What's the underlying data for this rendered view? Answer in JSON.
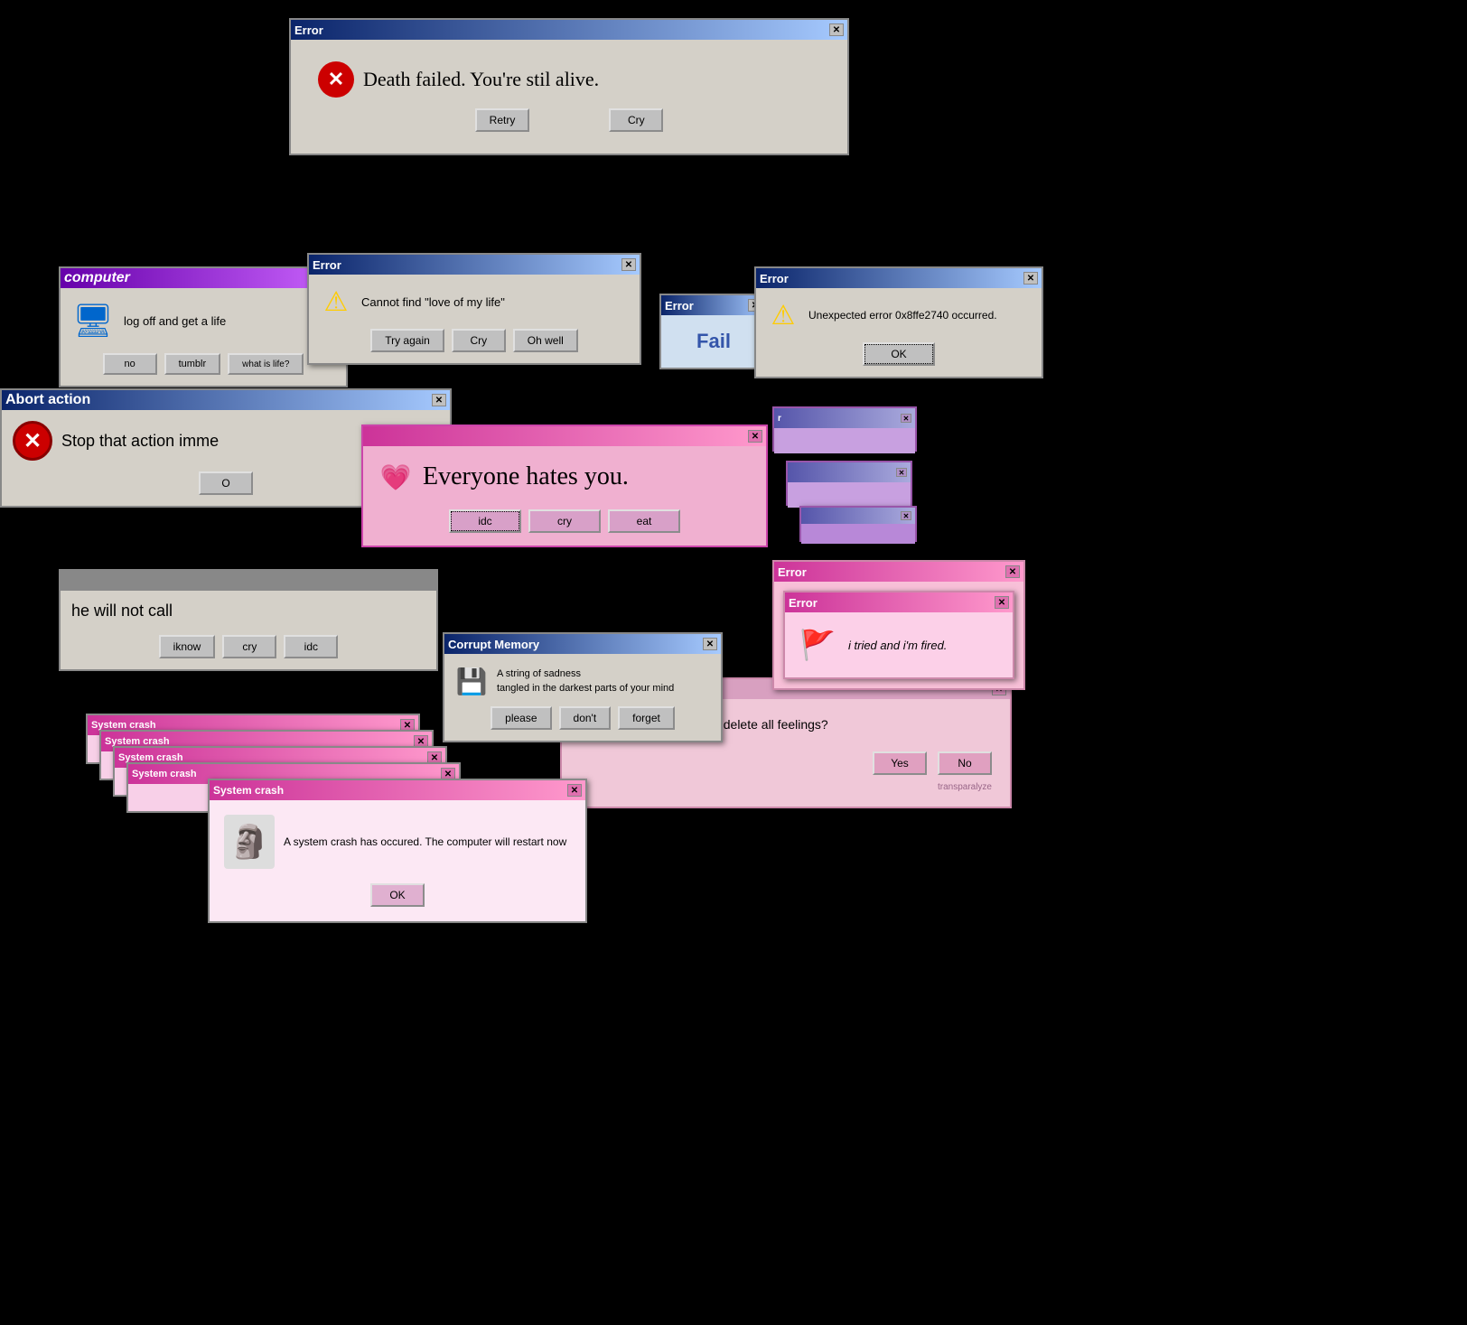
{
  "windows": {
    "death_error": {
      "title": "Error",
      "message": "Death failed. You're stil alive.",
      "btn1": "Retry",
      "btn2": "Cry"
    },
    "love_error": {
      "title": "Error",
      "message": "Cannot find \"love of my life\"",
      "btn1": "Try again",
      "btn2": "Cry",
      "btn3": "Oh well"
    },
    "computer": {
      "title": "computer",
      "message": "log off and get a life",
      "btn1": "no",
      "btn2": "tumblr",
      "btn3": "what is life?"
    },
    "unexpected": {
      "title": "Error",
      "message": "Unexpected error 0x8ffe2740 occurred.",
      "btn1": "OK"
    },
    "fail": {
      "title": "Error",
      "label": "Fail"
    },
    "abort": {
      "title": "Abort action",
      "message": "Stop that action imme",
      "btn1": "O"
    },
    "everyone": {
      "title": "",
      "message": "Everyone hates you.",
      "btn1": "idc",
      "btn2": "cry",
      "btn3": "eat"
    },
    "call": {
      "message": "he will not call",
      "btn1": "iknow",
      "btn2": "cry",
      "btn3": "idc"
    },
    "corrupt": {
      "title": "Corrupt Memory",
      "message": "A string of sadness\ntangled in the darkest parts of your mind",
      "btn1": "please",
      "btn2": "don't",
      "btn3": "forget"
    },
    "feelings": {
      "message": "Are you sure you want to delete all feelings?",
      "btn1": "Yes",
      "btn2": "No",
      "watermark": "transparalyze"
    },
    "tried": {
      "title": "Error",
      "title2": "Error",
      "message": "i tried and i'm fired."
    },
    "crash_stack": {
      "title": "System crash"
    },
    "crash_main": {
      "title": "System crash",
      "message": "A system crash has occured. The computer will restart now",
      "btn1": "OK"
    }
  }
}
